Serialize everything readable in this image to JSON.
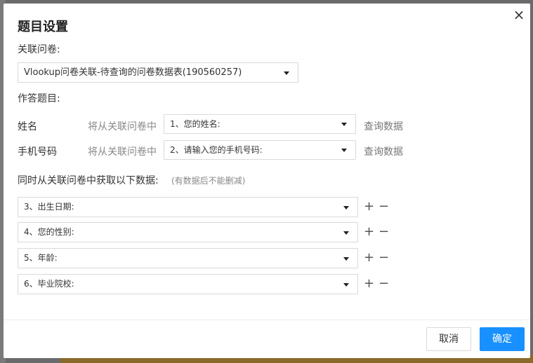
{
  "dialog": {
    "title": "题目设置",
    "close_icon": "×",
    "linked_survey_label": "关联问卷:",
    "linked_survey_value": "Vlookup问卷关联-待查询的问卷数据表(190560257)",
    "answer_questions_label": "作答题目:",
    "fields": [
      {
        "name": "姓名",
        "hint": "将从关联问卷中",
        "selected": "1、您的姓名:",
        "action": "查询数据"
      },
      {
        "name": "手机号码",
        "hint": "将从关联问卷中",
        "selected": "2、请输入您的手机号码:",
        "action": "查询数据"
      }
    ],
    "fetch_label": "同时从关联问卷中获取以下数据:",
    "fetch_note": "(有数据后不能删减)",
    "fetch_items": [
      {
        "selected": "3、出生日期:"
      },
      {
        "selected": "4、您的性别:"
      },
      {
        "selected": "5、年龄:"
      },
      {
        "selected": "6、毕业院校:"
      }
    ],
    "plus_icon": "+",
    "minus_icon": "−",
    "cancel_label": "取消",
    "ok_label": "确定"
  }
}
